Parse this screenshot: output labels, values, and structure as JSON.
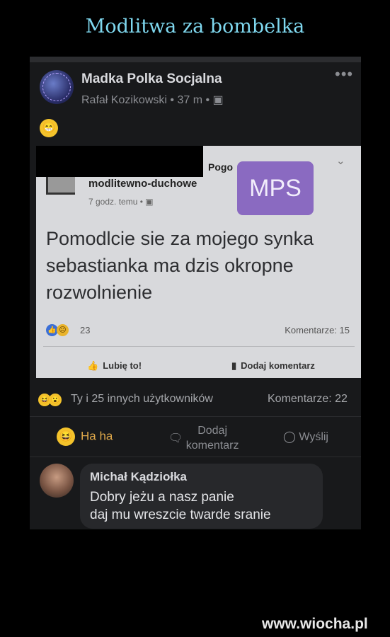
{
  "page": {
    "title": "Modlitwa za bombelka",
    "watermark": "www.wiocha.pl"
  },
  "post": {
    "group_name": "Madka Polka Socjalna",
    "author": "Rafał Kozikowski",
    "time": "37 m",
    "meta_separator": "•",
    "more_icon": "•••",
    "emoji": "😁"
  },
  "shared": {
    "page_name_partial": "Pogo",
    "page_name": "modlitewno-duchowe",
    "time": "7 godz. temu",
    "badge": "MPS",
    "text": "Pomodlcie sie za mojego synka sebastianka ma dzis okropne rozwolnienie",
    "reaction_count": "23",
    "comments": "Komentarze: 15",
    "like_label": "Lubię to!",
    "comment_label": "Dodaj komentarz"
  },
  "reactions": {
    "summary": "Ty i 25 innych użytkowników",
    "comments": "Komentarze: 22"
  },
  "actions": {
    "haha": "Ha ha",
    "comment_line1": "Dodaj",
    "comment_line2": "komentarz",
    "share": "Wyślij"
  },
  "comment": {
    "name": "Michał Kądziołka",
    "line1": "Dobry jeżu a nasz panie",
    "line2": "daj mu wreszcie twarde sranie"
  },
  "colors": {
    "title": "#7fd8ef",
    "haha": "#e0a94a",
    "badge": "#8a6ac1"
  }
}
